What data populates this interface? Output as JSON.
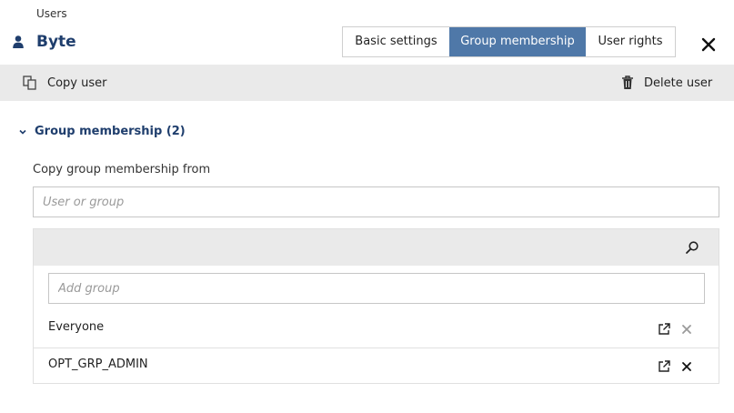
{
  "breadcrumb": "Users",
  "header": {
    "title": "Byte",
    "icon": "user-icon"
  },
  "tabs": [
    {
      "label": "Basic settings",
      "active": false
    },
    {
      "label": "Group membership",
      "active": true
    },
    {
      "label": "User rights",
      "active": false
    }
  ],
  "toolbar": {
    "copy_label": "Copy user",
    "delete_label": "Delete user"
  },
  "section": {
    "title": "Group membership (2)",
    "expanded": true
  },
  "copy_from": {
    "label": "Copy group membership from",
    "placeholder": "User or group",
    "value": ""
  },
  "groups_panel": {
    "add_placeholder": "Add group",
    "items": [
      {
        "label": "Everyone",
        "remove_enabled": false
      },
      {
        "label": "OPT_GRP_ADMIN",
        "remove_enabled": true
      }
    ]
  },
  "colors": {
    "accent": "#4f78a8",
    "title": "#1f3e6d",
    "toolbar_bg": "#eaeaea"
  }
}
